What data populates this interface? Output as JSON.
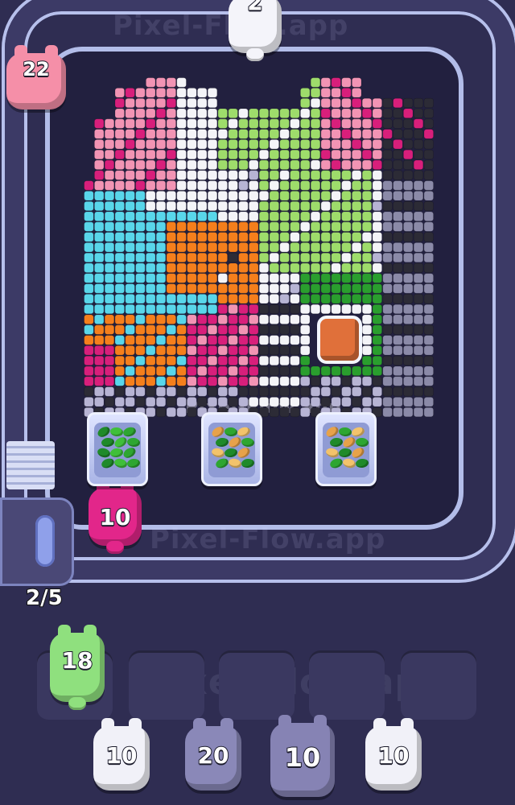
{
  "watermark": {
    "text": "Pixel-Flow.app"
  },
  "conveyor": {
    "pigs": [
      {
        "id": "top-pig",
        "count": "2",
        "color": "#f4f4fa"
      },
      {
        "id": "corner-pig",
        "count": "22",
        "color": "#f58fa8"
      },
      {
        "id": "dispense-pig",
        "count": "10",
        "color": "#e2268a"
      }
    ]
  },
  "trays": [
    {
      "id": "tray-1",
      "contents": "green-beans"
    },
    {
      "id": "tray-2",
      "contents": "mixed-beans"
    },
    {
      "id": "tray-3",
      "contents": "mixed-beans"
    }
  ],
  "queue": {
    "progress": "2/5"
  },
  "slots": {
    "active_pig": {
      "count": "18",
      "color": "#8fe07e"
    }
  },
  "bench": [
    {
      "count": "10",
      "color": "#f1f1f8"
    },
    {
      "count": "20",
      "color": "#8a88b8"
    },
    {
      "count": "10",
      "color": "#8683b4"
    },
    {
      "count": "10",
      "color": "#f1f1f8"
    }
  ],
  "colors": {
    "pink": "#f294b4",
    "magenta": "#d81f7b",
    "white": "#f4f4f8",
    "cyan": "#59d6ea",
    "orange": "#f57f1c",
    "light-green": "#9edc6b",
    "green": "#2a9e2e",
    "gray": "#8b8aa8",
    "dark": "#2c2b36",
    "lavender": "#b7b4d4"
  }
}
